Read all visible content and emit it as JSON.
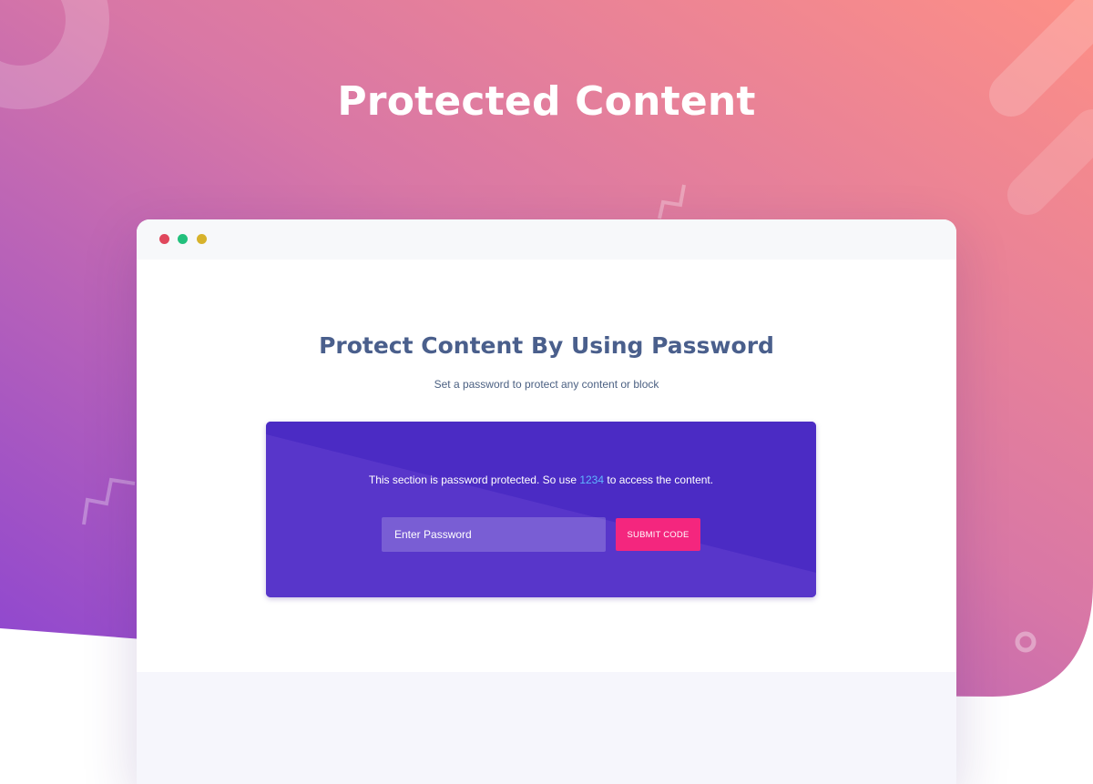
{
  "colors": {
    "gradient_start": "#8a44d2",
    "gradient_end": "#fd8f86",
    "title_color": "#4a5f8c",
    "box_color": "#5533c8",
    "button_color": "#f4267e",
    "code_color": "#5fb6ff"
  },
  "hero": {
    "title": "Protected Content"
  },
  "window_controls": [
    "red-dot",
    "green-dot",
    "yellow-dot"
  ],
  "page": {
    "title": "Protect Content By Using Password",
    "subtitle": "Set a password to protect any content or block"
  },
  "protect_box": {
    "message_before": "This section is password protected. So use ",
    "code": "1234",
    "message_after": " to access the content.",
    "input_placeholder": "Enter Password",
    "submit_label": "SUBMIT CODE"
  }
}
